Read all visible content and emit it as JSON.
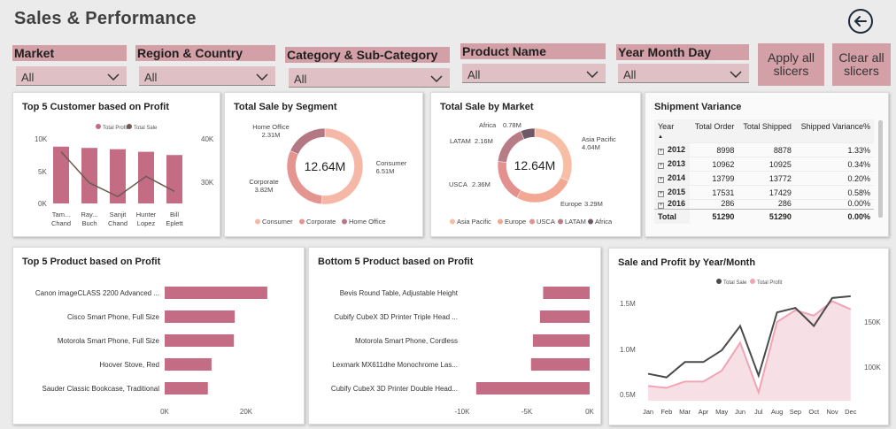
{
  "header": {
    "title": "Sales & Performance"
  },
  "slicers": [
    {
      "label": "Market",
      "value": "All"
    },
    {
      "label": "Region & Country",
      "value": "All"
    },
    {
      "label": "Category & Sub-Category",
      "value": "All"
    },
    {
      "label": "Product Name",
      "value": "All"
    },
    {
      "label": "Year Month Day",
      "value": "All"
    }
  ],
  "buttons": {
    "apply": "Apply all slicers",
    "clear": "Clear all slicers"
  },
  "top5_customer": {
    "title": "Top 5 Customer based on Profit",
    "legend": [
      "Total Profit",
      "Total Sale"
    ],
    "left_ticks": [
      "10K",
      "5K",
      "0K"
    ],
    "right_ticks": [
      "40K",
      "30K"
    ],
    "customers": [
      {
        "name1": "Tam...",
        "name2": "Chand",
        "profit": 8800,
        "sale": 37800
      },
      {
        "name1": "Ray...",
        "name2": "Buch",
        "profit": 8600,
        "sale": 30100
      },
      {
        "name1": "Sanjit",
        "name2": "Chand",
        "profit": 8400,
        "sale": 26700
      },
      {
        "name1": "Hunter",
        "name2": "Lopez",
        "profit": 8000,
        "sale": 31700
      },
      {
        "name1": "Bill",
        "name2": "Eplett",
        "profit": 7500,
        "sale": 28000
      }
    ]
  },
  "segment": {
    "title": "Total Sale by Segment",
    "center": "12.64M",
    "labels": [
      {
        "name": "Home Office",
        "value": "2.31M"
      },
      {
        "name": "Corporate",
        "value": "3.82M"
      },
      {
        "name": "Consumer",
        "value": "6.51M"
      }
    ],
    "legend": [
      "Consumer",
      "Corporate",
      "Home Office"
    ]
  },
  "market": {
    "title": "Total Sale by Market",
    "center": "12.64M",
    "labels": [
      {
        "name": "Africa",
        "value": "0.78M"
      },
      {
        "name": "LATAM",
        "value": "2.16M"
      },
      {
        "name": "USCA",
        "value": "2.36M"
      },
      {
        "name": "Asia Pacific",
        "value": "4.04M"
      },
      {
        "name": "Europe",
        "value": "3.29M"
      }
    ],
    "legend": [
      "Asia Pacific",
      "Europe",
      "USCA",
      "LATAM",
      "Africa"
    ]
  },
  "shipment": {
    "title": "Shipment Variance",
    "headers": [
      "Year",
      "Total Order",
      "Total Shipped",
      "Shipped Variance%"
    ],
    "rows": [
      [
        "2012",
        "8998",
        "8878",
        "1.33%"
      ],
      [
        "2013",
        "10962",
        "10925",
        "0.34%"
      ],
      [
        "2014",
        "13799",
        "13772",
        "0.20%"
      ],
      [
        "2015",
        "17531",
        "17429",
        "0.58%"
      ],
      [
        "2016",
        "286",
        "286",
        "0.00%"
      ]
    ],
    "total": [
      "Total",
      "51290",
      "51290",
      "0.00%"
    ]
  },
  "top5_product": {
    "title": "Top 5 Product based on Profit",
    "ticks": [
      "0K",
      "20K"
    ]
  },
  "bottom5_product": {
    "title": "Bottom 5 Product based on Profit",
    "ticks": [
      "-10K",
      "-5K",
      "0K"
    ]
  },
  "sale_profit": {
    "title": "Sale and Profit by Year/Month",
    "legend": [
      "Total Sale",
      "Total Profit"
    ],
    "left_ticks": [
      "1.5M",
      "1.0M",
      "0.5M"
    ],
    "right_ticks": [
      "150K",
      "100K"
    ]
  },
  "chart_data": [
    {
      "type": "bar",
      "title": "Top 5 Customer based on Profit",
      "categories": [
        "Tam... Chand",
        "Ray... Buch",
        "Sanjit Chand",
        "Hunter Lopez",
        "Bill Eplett"
      ],
      "series": [
        {
          "name": "Total Profit",
          "values": [
            8800,
            8600,
            8400,
            8000,
            7500
          ]
        },
        {
          "name": "Total Sale",
          "values": [
            37800,
            30100,
            26700,
            31700,
            28000
          ]
        }
      ],
      "ylim": [
        0,
        10000
      ],
      "y2lim": [
        25000,
        41000
      ],
      "legend": "top-center"
    },
    {
      "type": "pie",
      "title": "Total Sale by Segment",
      "categories": [
        "Consumer",
        "Corporate",
        "Home Office"
      ],
      "values": [
        6.51,
        3.82,
        2.31
      ],
      "colors": [
        "#f6b8a6",
        "#e5958f",
        "#b37884"
      ]
    },
    {
      "type": "pie",
      "title": "Total Sale by Market",
      "categories": [
        "Asia Pacific",
        "Europe",
        "USCA",
        "LATAM",
        "Africa"
      ],
      "values": [
        4.04,
        3.29,
        2.36,
        2.16,
        0.78
      ],
      "colors": [
        "#f6bfa5",
        "#f3a893",
        "#e2918e",
        "#b87c87",
        "#6d5a66"
      ]
    },
    {
      "type": "bar",
      "title": "Top 5 Product based on Profit",
      "categories": [
        "Canon imageCLASS 2200 Advanced ...",
        "Cisco Smart Phone, Full Size",
        "Motorola Smart Phone, Full Size",
        "Hoover Stove, Red",
        "Sauder Classic Bookcase, Traditional"
      ],
      "values": [
        25200,
        17200,
        17000,
        11500,
        10600
      ],
      "xlim": [
        0,
        30000
      ]
    },
    {
      "type": "bar",
      "title": "Bottom 5 Product based on Profit",
      "categories": [
        "Bevis Round Table, Adjustable Height",
        "Cubify CubeX 3D Printer Triple Head ...",
        "Motorola Smart Phone, Cordless",
        "Lexmark MX611dhe Monochrome Las...",
        "Cubify CubeX 3D Printer Double Head..."
      ],
      "values": [
        -3650,
        -3900,
        -4450,
        -4600,
        -8900
      ],
      "xlim": [
        -10000,
        0
      ]
    },
    {
      "type": "line",
      "title": "Sale and Profit by Year/Month",
      "x": [
        "Jan",
        "Feb",
        "Mar",
        "Apr",
        "May",
        "Jun",
        "Jul",
        "Aug",
        "Sep",
        "Oct",
        "Nov",
        "Dec"
      ],
      "series": [
        {
          "name": "Total Sale",
          "values": [
            0.72,
            0.68,
            0.85,
            0.85,
            0.98,
            1.25,
            0.7,
            1.4,
            1.45,
            1.25,
            1.56,
            1.58
          ]
        },
        {
          "name": "Total Profit",
          "values": [
            79000,
            77000,
            84000,
            84000,
            96000,
            127000,
            72000,
            150000,
            163000,
            157000,
            173000,
            164000
          ]
        }
      ],
      "ylim": [
        0.4,
        1.75
      ],
      "y2lim": [
        60000,
        190000
      ],
      "legend": "top-center"
    }
  ]
}
